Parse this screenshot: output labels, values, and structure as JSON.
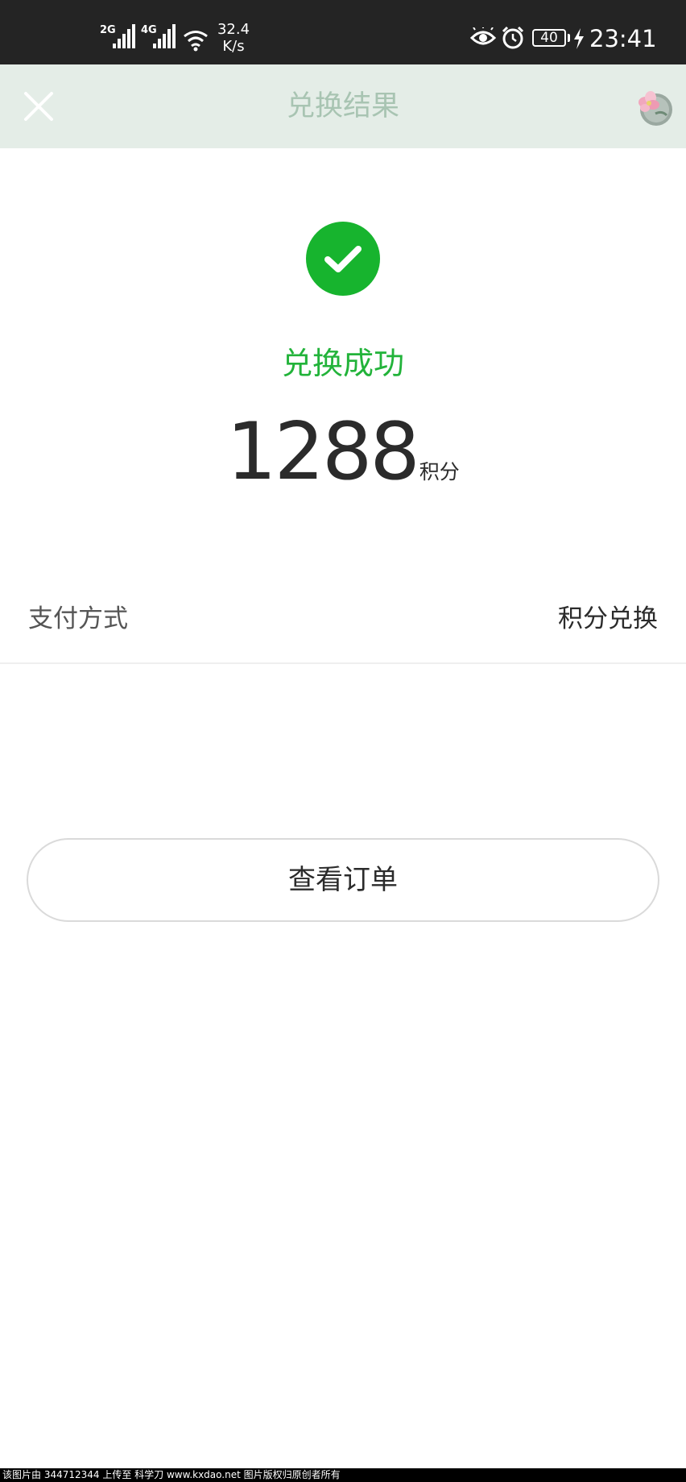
{
  "status_bar": {
    "network_1": "2G",
    "network_2": "4G",
    "speed_value": "32.4",
    "speed_unit": "K/s",
    "battery": "40",
    "time": "23:41"
  },
  "nav": {
    "title": "兑换结果",
    "close_icon": "close-icon",
    "avatar_icon": "flower-avatar"
  },
  "result": {
    "status_text": "兑换成功",
    "points_value": "1288",
    "points_unit": "积分",
    "status_color": "#22b33a"
  },
  "payment": {
    "label": "支付方式",
    "value": "积分兑换"
  },
  "actions": {
    "view_order_label": "查看订单"
  },
  "watermark": {
    "text": "该图片由 344712344 上传至 科学刀 www.kxdao.net 图片版权归原创者所有"
  }
}
